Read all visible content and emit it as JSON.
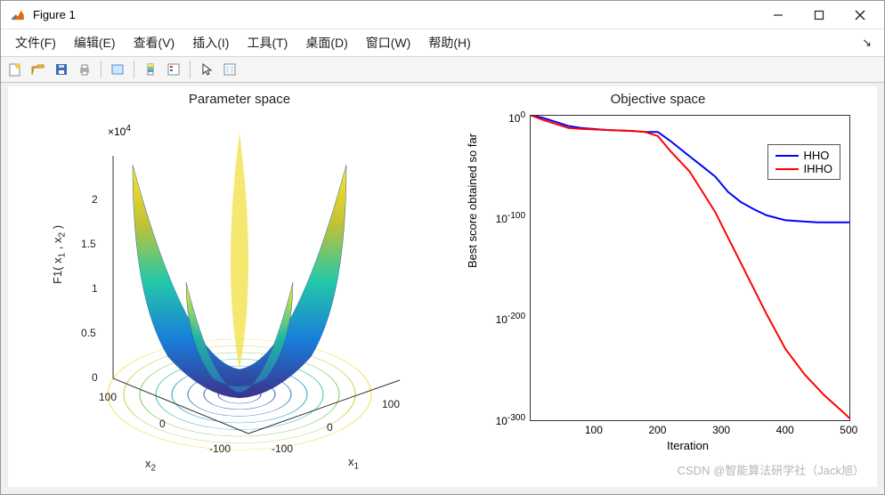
{
  "window": {
    "title": "Figure 1"
  },
  "menu": {
    "file": "文件(F)",
    "edit": "编辑(E)",
    "view": "查看(V)",
    "insert": "插入(I)",
    "tools": "工具(T)",
    "desktop": "桌面(D)",
    "window": "窗口(W)",
    "help": "帮助(H)"
  },
  "left_plot": {
    "title": "Parameter space",
    "zlabel_prefix": "F1( x",
    "zlabel_mid": " , x",
    "zlabel_suffix": " )",
    "xlabel_base": "x",
    "xlabel_sub": "1",
    "ylabel_base": "x",
    "ylabel_sub": "2",
    "multiplier": "×10",
    "multiplier_exp": "4",
    "xticks": [
      "-100",
      "0",
      "100"
    ],
    "yticks": [
      "-100",
      "0",
      "100"
    ],
    "zticks": [
      "0",
      "0.5",
      "1",
      "1.5",
      "2"
    ]
  },
  "right_plot": {
    "title": "Objective space",
    "xlabel": "Iteration",
    "ylabel": "Best score obtained so far",
    "xticks": [
      "100",
      "200",
      "300",
      "400",
      "500"
    ],
    "ytick_base": "10",
    "ytick_exps": [
      "0",
      "-100",
      "-200",
      "-300"
    ],
    "legend": {
      "s1": "HHO",
      "s2": "IHHO"
    },
    "colors": {
      "s1": "#0000ff",
      "s2": "#ff0000"
    }
  },
  "watermark": "CSDN @智能算法研学社（Jack旭）",
  "chart_data": [
    {
      "type": "surface",
      "title": "Parameter space",
      "xlabel": "x_1",
      "ylabel": "x_2",
      "zlabel": "F1( x_1 , x_2 )",
      "xlim": [
        -100,
        100
      ],
      "ylim": [
        -100,
        100
      ],
      "zlim": [
        0,
        20000
      ],
      "z_multiplier_display": 10000,
      "note": "3D surface of Sphere-like benchmark function (bowl shape) with contour underneath; peaks at corners (~2e4) and min at origin (0).",
      "colormap": "parula"
    },
    {
      "type": "line",
      "title": "Objective space",
      "xlabel": "Iteration",
      "ylabel": "Best score obtained so far",
      "xlim": [
        1,
        500
      ],
      "ylim": [
        1e-300,
        1
      ],
      "yscale": "log",
      "legend_position": "upper right",
      "series": [
        {
          "name": "HHO",
          "color": "#0000ff",
          "x": [
            1,
            20,
            40,
            60,
            80,
            120,
            160,
            180,
            200,
            220,
            250,
            270,
            290,
            310,
            330,
            350,
            370,
            400,
            450,
            500
          ],
          "y_log10": [
            0.5,
            -2,
            -6,
            -10,
            -12,
            -14,
            -15,
            -16,
            -16,
            -25,
            -40,
            -50,
            -60,
            -75,
            -85,
            -92,
            -98,
            -103,
            -105,
            -105
          ]
        },
        {
          "name": "IHHO",
          "color": "#ff0000",
          "x": [
            1,
            20,
            40,
            60,
            80,
            120,
            160,
            180,
            200,
            220,
            250,
            270,
            290,
            310,
            330,
            350,
            370,
            400,
            430,
            460,
            490,
            500
          ],
          "y_log10": [
            0.5,
            -4,
            -8,
            -12,
            -13,
            -14,
            -15,
            -16,
            -20,
            -35,
            -55,
            -75,
            -95,
            -120,
            -145,
            -170,
            -195,
            -230,
            -255,
            -275,
            -292,
            -298
          ]
        }
      ]
    }
  ]
}
